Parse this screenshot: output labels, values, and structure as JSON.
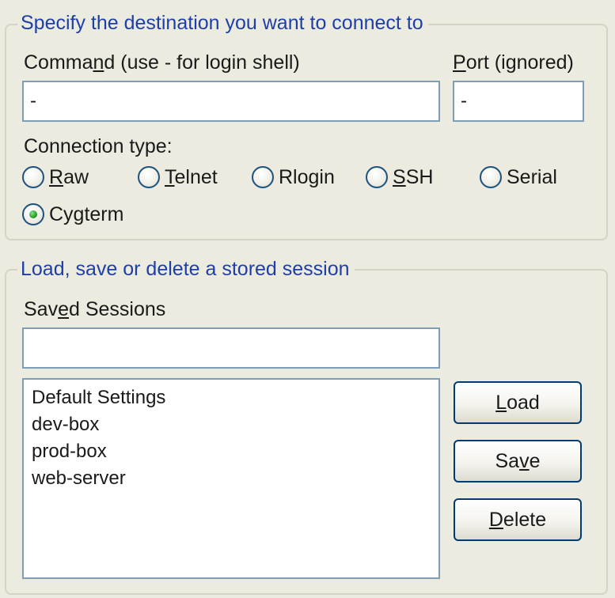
{
  "destination_group": {
    "title": "Specify the destination you want to connect to",
    "command_label": {
      "pre": "Comma",
      "accel": "n",
      "post": "d (use - for login shell)"
    },
    "command_value": "-",
    "port_label": {
      "pre": "",
      "accel": "P",
      "post": "ort (ignored)"
    },
    "port_value": "-",
    "connection_type_label": "Connection type:",
    "connection_types": [
      {
        "pre": "",
        "accel": "R",
        "post": "aw",
        "selected": false
      },
      {
        "pre": "",
        "accel": "T",
        "post": "elnet",
        "selected": false
      },
      {
        "pre": "Rlo",
        "accel": "g",
        "post": "in",
        "selected": false
      },
      {
        "pre": "",
        "accel": "S",
        "post": "SH",
        "selected": false
      },
      {
        "pre": "Serial",
        "accel": "",
        "post": "",
        "selected": false
      },
      {
        "pre": "Cygterm",
        "accel": "",
        "post": "",
        "selected": true
      }
    ]
  },
  "session_group": {
    "title": "Load, save or delete a stored session",
    "saved_sessions_label": {
      "pre": "Sav",
      "accel": "e",
      "post": "d Sessions"
    },
    "saved_sessions_value": "",
    "sessions": [
      "Default Settings",
      "dev-box",
      "prod-box",
      "web-server"
    ],
    "buttons": {
      "load": {
        "pre": "",
        "accel": "L",
        "post": "oad"
      },
      "save": {
        "pre": "Sa",
        "accel": "v",
        "post": "e"
      },
      "delete": {
        "pre": "",
        "accel": "D",
        "post": "elete"
      }
    }
  },
  "colors": {
    "group_title": "#1f3fa8",
    "textbox_border": "#7f9db9",
    "button_border": "#003c74",
    "radio_selected": "#21a121",
    "background": "#ecebe0"
  }
}
